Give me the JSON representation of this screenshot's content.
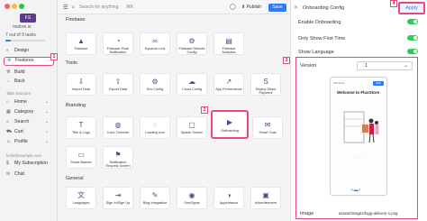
{
  "app": {
    "logo_text": "FS",
    "name": "mstore.io",
    "task_status": "7 out of 9 tasks",
    "task_progress": 0.14
  },
  "sidebar": {
    "items": [
      {
        "label": "Design",
        "icon": "palette-icon",
        "icon_char": "◐"
      },
      {
        "label": "Features",
        "icon": "gear-icon",
        "icon_char": "⚙"
      },
      {
        "label": "Build",
        "icon": "hammer-icon",
        "icon_char": "⚒"
      },
      {
        "label": "Back",
        "icon": "back-arrow-icon",
        "icon_char": "←"
      }
    ],
    "tabs_section": "Tabs structure",
    "tabs": [
      {
        "label": "Home",
        "icon": "home-icon",
        "icon_char": "⌂"
      },
      {
        "label": "Category",
        "icon": "category-icon",
        "icon_char": "▦"
      },
      {
        "label": "Search",
        "icon": "search-icon",
        "icon_char": "⌕"
      },
      {
        "label": "Cart",
        "icon": "cart-icon",
        "icon_char": "⛟"
      },
      {
        "label": "Profile",
        "icon": "profile-icon",
        "icon_char": "☺"
      }
    ],
    "account_email": "hello@example.com",
    "subscription": "My Subscription",
    "chat": "Chat"
  },
  "toolbar": {
    "search_placeholder": "Search for anything",
    "search_shortcut": "⌘K",
    "publish_label": "Publish",
    "save_label": "Save"
  },
  "sections": [
    {
      "title": "Firebase",
      "tiles": [
        {
          "label": "Firebase",
          "icon": "firebase-icon",
          "icon_char": "▲"
        },
        {
          "label": "Firebase Push Notification",
          "icon": "bell-icon",
          "icon_char": "◔"
        },
        {
          "label": "Dynamic Link",
          "icon": "link-icon",
          "icon_char": "∞"
        },
        {
          "label": "Firebase Remote Config",
          "icon": "remote-config-icon",
          "icon_char": "⚙"
        },
        {
          "label": "Firebase Analytics",
          "icon": "analytics-icon",
          "icon_char": "▤"
        }
      ]
    },
    {
      "title": "Tools",
      "tiles": [
        {
          "label": "Import Data",
          "icon": "import-icon",
          "icon_char": "⇩"
        },
        {
          "label": "Export Data",
          "icon": "export-icon",
          "icon_char": "⇧"
        },
        {
          "label": "Env Config",
          "icon": "env-config-icon",
          "icon_char": "⚙"
        },
        {
          "label": "Cloud Config",
          "icon": "cloud-icon",
          "icon_char": "☁"
        },
        {
          "label": "App Performance",
          "icon": "performance-icon",
          "icon_char": "↗"
        },
        {
          "label": "Deploy Stripe Payment",
          "icon": "stripe-icon",
          "icon_char": "S"
        }
      ]
    },
    {
      "title": "Branding",
      "tiles": [
        {
          "label": "Title & Logo",
          "icon": "title-logo-icon",
          "icon_char": "T"
        },
        {
          "label": "Color Override",
          "icon": "color-icon",
          "icon_char": "◍"
        },
        {
          "label": "Loading Icon",
          "icon": "loading-icon",
          "icon_char": "◌"
        },
        {
          "label": "Splash Screen",
          "icon": "splash-icon",
          "icon_char": "▢"
        },
        {
          "label": "Onboarding",
          "icon": "onboarding-icon",
          "icon_char": "▶"
        },
        {
          "label": "Smart Chat",
          "icon": "chat-icon",
          "icon_char": "✉"
        },
        {
          "label": "Smart Banner",
          "icon": "banner-icon",
          "icon_char": "▭"
        },
        {
          "label": "Notification Request Screen",
          "icon": "notification-icon",
          "icon_char": "⚑"
        }
      ]
    },
    {
      "title": "General",
      "tiles": [
        {
          "label": "Languages",
          "icon": "language-icon",
          "icon_char": "文"
        },
        {
          "label": "Sign In/Sign Up",
          "icon": "sign-in-icon",
          "icon_char": "⇥"
        },
        {
          "label": "Blog Integration",
          "icon": "blog-icon",
          "icon_char": "✎"
        },
        {
          "label": "OneSignal",
          "icon": "onesignal-icon",
          "icon_char": "◉"
        },
        {
          "label": "Appearance",
          "icon": "appearance-icon",
          "icon_char": "◑"
        },
        {
          "label": "Advertisement",
          "icon": "ad-icon",
          "icon_char": "▣"
        }
      ]
    }
  ],
  "panel": {
    "title": "Onboarding Config",
    "apply_label": "Apply",
    "enable_onboarding": "Enable Onboarding",
    "only_show_first": "Only Show First Time",
    "show_language": "Show Language",
    "version_label": "Version",
    "version_value": "1",
    "image_label": "Image",
    "image_path": "assets/images/fogg-delivery-1.png",
    "preview_brand": "FluxStore",
    "preview_skip": "Skip",
    "preview_welcome": "Welcome to FluxStore"
  },
  "callouts": [
    "1",
    "2",
    "3",
    "4"
  ],
  "colors": {
    "accent": "#2a79ff",
    "highlight": "#e84a7f",
    "toggle_on": "#34c759"
  }
}
